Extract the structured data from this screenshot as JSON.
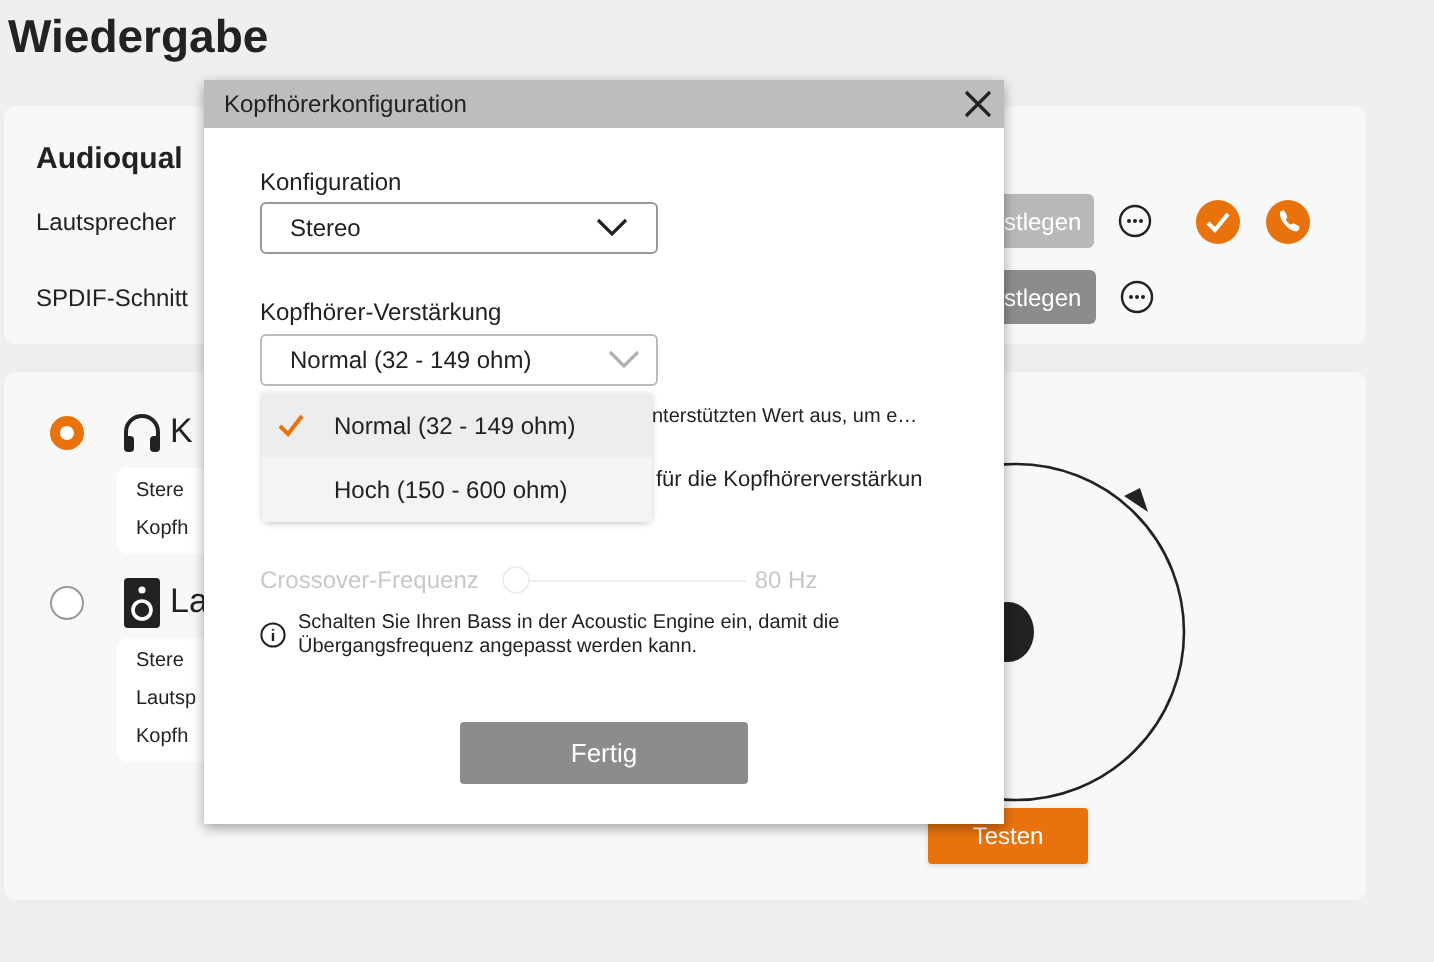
{
  "page_title": "Wiedergabe",
  "audio_quality": {
    "title": "Audioqual",
    "rows": [
      {
        "label": "Lautsprecher",
        "button": "stlegen",
        "disabled": true,
        "indicators": [
          {
            "kind": "check"
          },
          {
            "kind": "phone"
          }
        ]
      },
      {
        "label": "SPDIF-Schnitt",
        "button": "stlegen",
        "disabled": false,
        "indicators": []
      }
    ]
  },
  "outputs": [
    {
      "kind": "headphones",
      "label": "K",
      "selected": true,
      "details": [
        "Stere",
        "Kopfh"
      ]
    },
    {
      "kind": "speaker",
      "label": "La",
      "selected": false,
      "details": [
        "Stere",
        "Lautsp",
        "Kopfh"
      ]
    }
  ],
  "test_button": "Testen",
  "dialog": {
    "title": "Kopfhörerkonfiguration",
    "configuration": {
      "label": "Konfiguration",
      "value": "Stereo"
    },
    "gain": {
      "label": "Kopfhörer-Verstärkung",
      "value": "Normal (32 - 149 ohm)",
      "expanded": true,
      "options": [
        {
          "label": "Normal (32 - 149 ohm)",
          "selected": true
        },
        {
          "label": "Hoch (150 - 600 ohm)",
          "selected": false
        }
      ]
    },
    "hidden_text": [
      "nterstützten Wert aus, um e…",
      "für die Kopfhörerverstärkun"
    ],
    "crossover": {
      "label": "Crossover-Frequenz",
      "disabled": true,
      "level": 0,
      "reading": "80 Hz"
    },
    "info": "Schalten Sie Ihren Bass in der Acoustic Engine ein, damit die Übergangsfrequenz angepasst werden kann.",
    "done_button": "Fertig"
  }
}
